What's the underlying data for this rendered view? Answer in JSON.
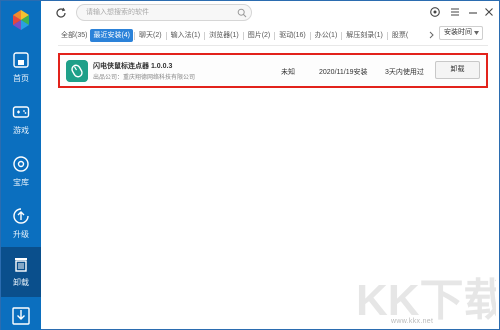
{
  "sidebar": {
    "items": [
      {
        "label": "首页",
        "icon": "home-icon"
      },
      {
        "label": "游戏",
        "icon": "gamepad-icon"
      },
      {
        "label": "宝库",
        "icon": "disc-icon"
      },
      {
        "label": "升级",
        "icon": "upgrade-icon"
      },
      {
        "label": "卸载",
        "icon": "trash-icon"
      }
    ],
    "active": "卸载",
    "accent": "#0b6fbf"
  },
  "search": {
    "placeholder": "请输入想搜索的软件"
  },
  "tabs": [
    {
      "label": "全部(35)",
      "active": false
    },
    {
      "label": "最近安装(4)",
      "active": true
    },
    {
      "label": "聊天(2)",
      "active": false
    },
    {
      "label": "输入法(1)",
      "active": false
    },
    {
      "label": "浏览器(1)",
      "active": false
    },
    {
      "label": "图片(2)",
      "active": false
    },
    {
      "label": "驱动(16)",
      "active": false
    },
    {
      "label": "办公(1)",
      "active": false
    },
    {
      "label": "解压刻录(1)",
      "active": false
    },
    {
      "label": "股票(",
      "active": false
    }
  ],
  "sort": {
    "selected": "安装时间"
  },
  "app_row": {
    "name": "闪电侠鼠标连点器 1.0.0.3",
    "publisher_label": "出品公司：",
    "publisher": "重庆翔德网络科技有限公司",
    "size": "未知",
    "installed": "2020/11/19安装",
    "usage": "3天内使用过",
    "uninstall_label": "卸载"
  },
  "watermark": {
    "text": "KK下载",
    "url": "www.kkx.net"
  }
}
